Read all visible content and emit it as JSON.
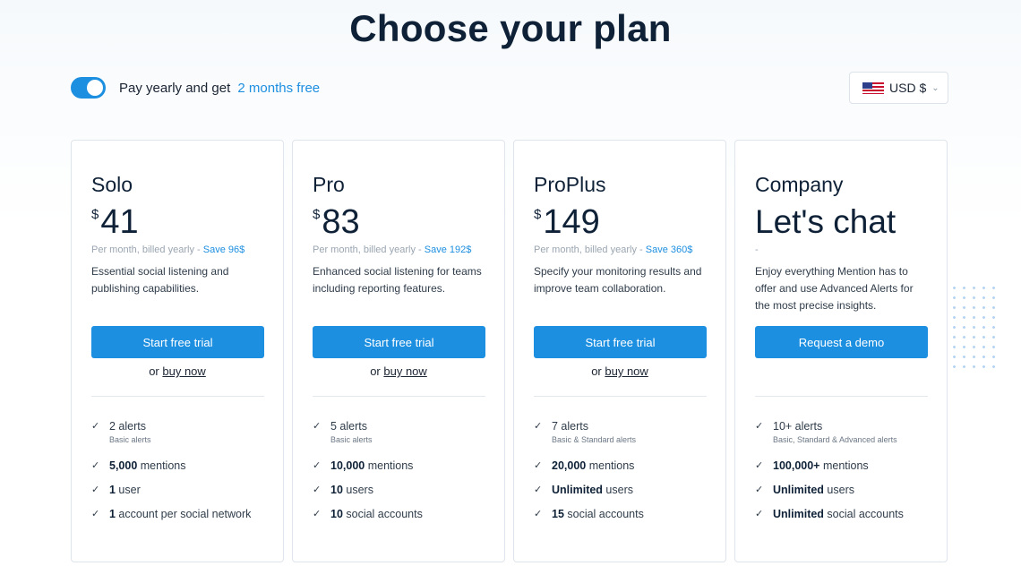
{
  "title": "Choose your plan",
  "billing_toggle": {
    "text": "Pay yearly and get",
    "highlight": "2 months free",
    "on": true
  },
  "currency": {
    "label": "USD $",
    "flag_icon": "us-flag-icon"
  },
  "colors": {
    "accent": "#1d8fe0",
    "heading": "#0f2137"
  },
  "plans": [
    {
      "name": "Solo",
      "currency_symbol": "$",
      "price": "41",
      "billing": "Per month, billed yearly -",
      "save": "Save 96$",
      "description": "Essential social listening and publishing capabilities.",
      "cta": "Start free trial",
      "or_text": "or",
      "buy_text": "buy now",
      "features": [
        {
          "bold": "",
          "text": "2 alerts",
          "sub": "Basic alerts"
        },
        {
          "bold": "5,000",
          "text": " mentions",
          "sub": ""
        },
        {
          "bold": "1",
          "text": " user",
          "sub": ""
        },
        {
          "bold": "1",
          "text": " account per social network",
          "sub": ""
        }
      ]
    },
    {
      "name": "Pro",
      "currency_symbol": "$",
      "price": "83",
      "billing": "Per month, billed yearly -",
      "save": "Save 192$",
      "description": "Enhanced social listening for teams including reporting features.",
      "cta": "Start free trial",
      "or_text": "or",
      "buy_text": "buy now",
      "features": [
        {
          "bold": "",
          "text": "5 alerts",
          "sub": "Basic alerts"
        },
        {
          "bold": "10,000",
          "text": " mentions",
          "sub": ""
        },
        {
          "bold": "10",
          "text": " users",
          "sub": ""
        },
        {
          "bold": "10",
          "text": " social accounts",
          "sub": ""
        }
      ]
    },
    {
      "name": "ProPlus",
      "currency_symbol": "$",
      "price": "149",
      "billing": "Per month, billed yearly -",
      "save": "Save 360$",
      "description": "Specify your monitoring results and improve team collaboration.",
      "cta": "Start free trial",
      "or_text": "or",
      "buy_text": "buy now",
      "features": [
        {
          "bold": "",
          "text": "7 alerts",
          "sub": "Basic & Standard alerts"
        },
        {
          "bold": "20,000",
          "text": " mentions",
          "sub": ""
        },
        {
          "bold": "Unlimited",
          "text": " users",
          "sub": ""
        },
        {
          "bold": "15",
          "text": " social accounts",
          "sub": ""
        }
      ]
    },
    {
      "name": "Company",
      "headline": "Let's chat",
      "billing_mark": "-",
      "description": "Enjoy everything Mention has to offer and use Advanced Alerts for the most precise insights.",
      "cta": "Request a demo",
      "features": [
        {
          "bold": "",
          "text": "10+ alerts",
          "sub": "Basic, Standard & Advanced alerts"
        },
        {
          "bold": "100,000+",
          "text": " mentions",
          "sub": ""
        },
        {
          "bold": "Unlimited",
          "text": " users",
          "sub": ""
        },
        {
          "bold": "Unlimited",
          "text": " social accounts",
          "sub": ""
        }
      ]
    }
  ]
}
